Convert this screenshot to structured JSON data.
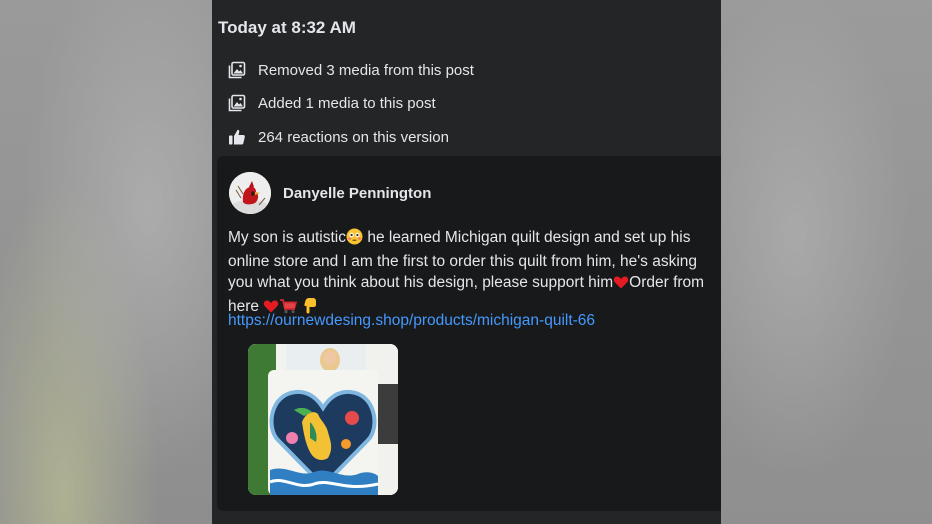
{
  "history": {
    "heading": "Today at 8:32 AM",
    "items": [
      {
        "icon": "media-icon",
        "text": "Removed 3 media from this post"
      },
      {
        "icon": "media-icon",
        "text": "Added 1 media to this post"
      },
      {
        "icon": "like-icon",
        "text": "264 reactions on this version"
      }
    ]
  },
  "post": {
    "author": "Danyelle Pennington",
    "text_1": "My son is autistic",
    "text_2": " he learned Michigan  quilt design and set up his online store and I am the first to order this quilt from him,  he's asking you what you think about his design, please support him",
    "text_3": "Order from here ",
    "emojis": [
      "flushed-face",
      "red-heart",
      "red-heart",
      "shopping-cart",
      "pointing-down"
    ],
    "link": "https://ournewdesing.shop/products/michigan-quilt-66",
    "image": "quilt-photo"
  },
  "colors": {
    "panel_bg": "#242526",
    "card_bg": "#18191a",
    "text": "#e4e6eb",
    "link": "#4599ff"
  }
}
